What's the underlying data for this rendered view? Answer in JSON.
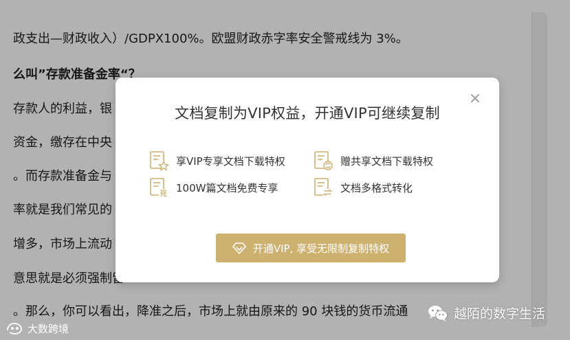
{
  "document": {
    "lines": [
      "政支出—财政收入）/GDPX100%。欧盟财政赤字率安全警戒线为 3%。",
      "么叫”存款准备金率“？",
      "存款人的利益，银",
      "资金，缴存在中央",
      "。而存款准备金与",
      "率就是我们常见的",
      "增多，市场上流动",
      "意思就是必须强制留",
      "。那么，你可以看出，降准之后，市场上就由原来的 90 块钱的货币流通"
    ]
  },
  "modal": {
    "title": "文档复制为VIP权益，开通VIP可继续复制",
    "close_label": "×",
    "benefits": [
      {
        "label": "享VIP专享文档下载特权",
        "icon": "document-star-icon"
      },
      {
        "label": "赠共享文档下载特权",
        "icon": "document-refresh-icon"
      },
      {
        "label": "100W篇文档免费专享",
        "icon": "document-free-icon"
      },
      {
        "label": "文档多格式转化",
        "icon": "document-convert-icon"
      }
    ],
    "cta_label": "开通VIP, 享受无限制复制特权",
    "accent_color": "#cfb16f"
  },
  "watermarks": {
    "left": "大数跨境",
    "right": "越陌的数字生活"
  }
}
